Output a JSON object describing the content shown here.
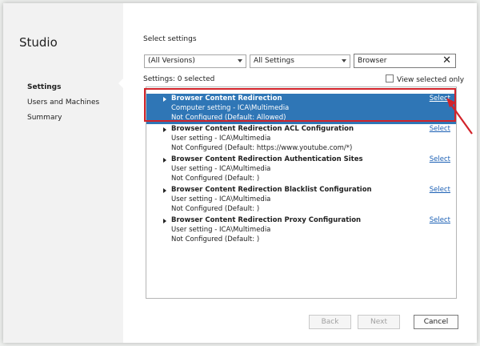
{
  "app": {
    "title": "Studio"
  },
  "sidebar": {
    "items": [
      {
        "label": "Settings",
        "active": true
      },
      {
        "label": "Users and Machines",
        "active": false
      },
      {
        "label": "Summary",
        "active": false
      }
    ]
  },
  "main": {
    "heading": "Select settings",
    "filters": {
      "version": "(All Versions)",
      "category": "All Settings",
      "search_value": "Browser"
    },
    "summary": "Settings: 0 selected",
    "view_selected_label": "View selected only",
    "settings": [
      {
        "name": "Browser Content Redirection",
        "path": "Computer setting - ICA\\Multimedia",
        "status": "Not Configured (Default: Allowed)",
        "action": "Select",
        "selected": true
      },
      {
        "name": "Browser Content Redirection ACL Configuration",
        "path": "User setting - ICA\\Multimedia",
        "status": "Not Configured (Default: https://www.youtube.com/*)",
        "action": "Select",
        "selected": false
      },
      {
        "name": "Browser Content Redirection Authentication Sites",
        "path": "User setting - ICA\\Multimedia",
        "status": "Not Configured (Default: )",
        "action": "Select",
        "selected": false
      },
      {
        "name": "Browser Content Redirection Blacklist Configuration",
        "path": "User setting - ICA\\Multimedia",
        "status": "Not Configured (Default: )",
        "action": "Select",
        "selected": false
      },
      {
        "name": "Browser Content Redirection Proxy Configuration",
        "path": "User setting - ICA\\Multimedia",
        "status": "Not Configured (Default: )",
        "action": "Select",
        "selected": false
      }
    ]
  },
  "footer": {
    "back_label": "Back",
    "next_label": "Next",
    "cancel_label": "Cancel"
  },
  "colors": {
    "selection": "#2f76b6",
    "highlight": "#d2232a",
    "link": "#1a5fb4"
  },
  "icons": {
    "expand": "expand-triangle-icon",
    "clear": "clear-icon",
    "dropdown": "chevron-down-icon",
    "annotation": "arrow-icon"
  }
}
